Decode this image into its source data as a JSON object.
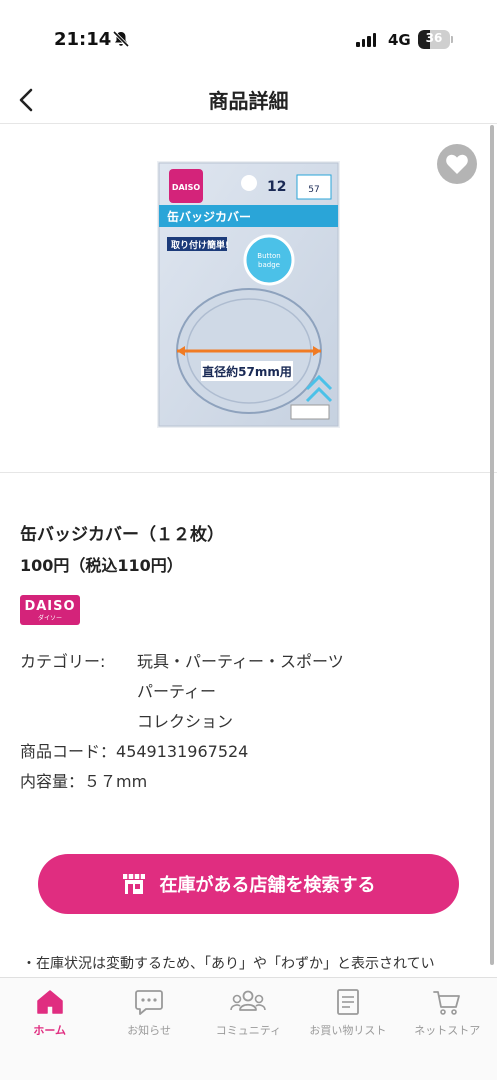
{
  "status_bar": {
    "time": "21:14",
    "network": "4G",
    "battery": "36",
    "battery_level": 0.36
  },
  "header": {
    "title": "商品詳細"
  },
  "product": {
    "name": "缶バッジカバー（１２枚）",
    "price": "100円（税込110円）",
    "brand_logo_text": "DAISO",
    "brand_logo_sub": "ダイソー",
    "category_label": "カテゴリー:",
    "categories": [
      "玩具・パーティー・スポーツ",
      "パーティー",
      "コレクション"
    ],
    "code_label": "商品コード：",
    "code": "4549131967524",
    "content_label": "内容量：",
    "content": "５７mm",
    "image_icon": "badge-cover-package-image"
  },
  "actions": {
    "store_search_label": "在庫がある店舗を検索する",
    "store_search_icon": "store-icon"
  },
  "notice": "・在庫状況は変動するため、「あり」や「わずか」と表示されてい",
  "tabs": [
    {
      "label": "ホーム",
      "icon": "home-icon",
      "active": true
    },
    {
      "label": "お知らせ",
      "icon": "chat-bubble-icon",
      "active": false
    },
    {
      "label": "コミュニティ",
      "icon": "community-icon",
      "active": false
    },
    {
      "label": "お買い物リスト",
      "icon": "shopping-list-icon",
      "active": false
    },
    {
      "label": "ネットストア",
      "icon": "cart-icon",
      "active": false
    }
  ],
  "colors": {
    "accent": "#e02d80",
    "brand": "#d4237a",
    "favorite_bg": "#b4b4b4"
  }
}
